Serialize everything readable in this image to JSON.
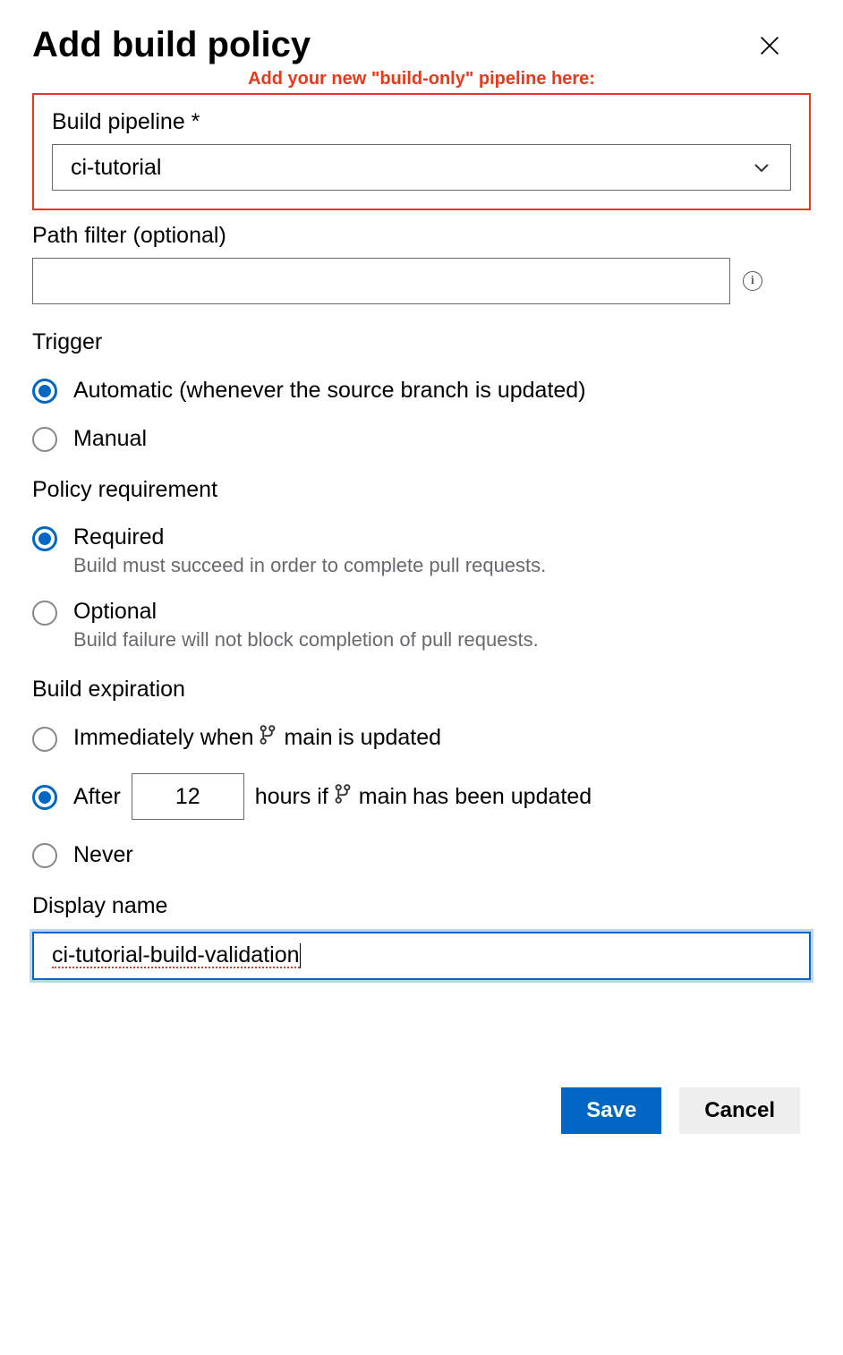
{
  "header": {
    "title": "Add build policy"
  },
  "annotation": "Add your new \"build-only\" pipeline here:",
  "buildPipeline": {
    "label": "Build pipeline *",
    "value": "ci-tutorial"
  },
  "pathFilter": {
    "label": "Path filter (optional)",
    "value": ""
  },
  "trigger": {
    "label": "Trigger",
    "options": {
      "auto": "Automatic (whenever the source branch is updated)",
      "manual": "Manual"
    },
    "selected": "auto"
  },
  "policyRequirement": {
    "label": "Policy requirement",
    "options": {
      "required": {
        "label": "Required",
        "desc": "Build must succeed in order to complete pull requests."
      },
      "optional": {
        "label": "Optional",
        "desc": "Build failure will not block completion of pull requests."
      }
    },
    "selected": "required"
  },
  "buildExpiration": {
    "label": "Build expiration",
    "branch": "main",
    "options": {
      "immediately_pre": "Immediately when ",
      "immediately_post": " is updated",
      "after_pre": "After",
      "after_mid": "hours if ",
      "after_post": " has been updated",
      "never": "Never"
    },
    "hours": "12",
    "selected": "after"
  },
  "displayName": {
    "label": "Display name",
    "value": "ci-tutorial-build-validation"
  },
  "buttons": {
    "save": "Save",
    "cancel": "Cancel"
  },
  "icons": {
    "info": "i"
  }
}
